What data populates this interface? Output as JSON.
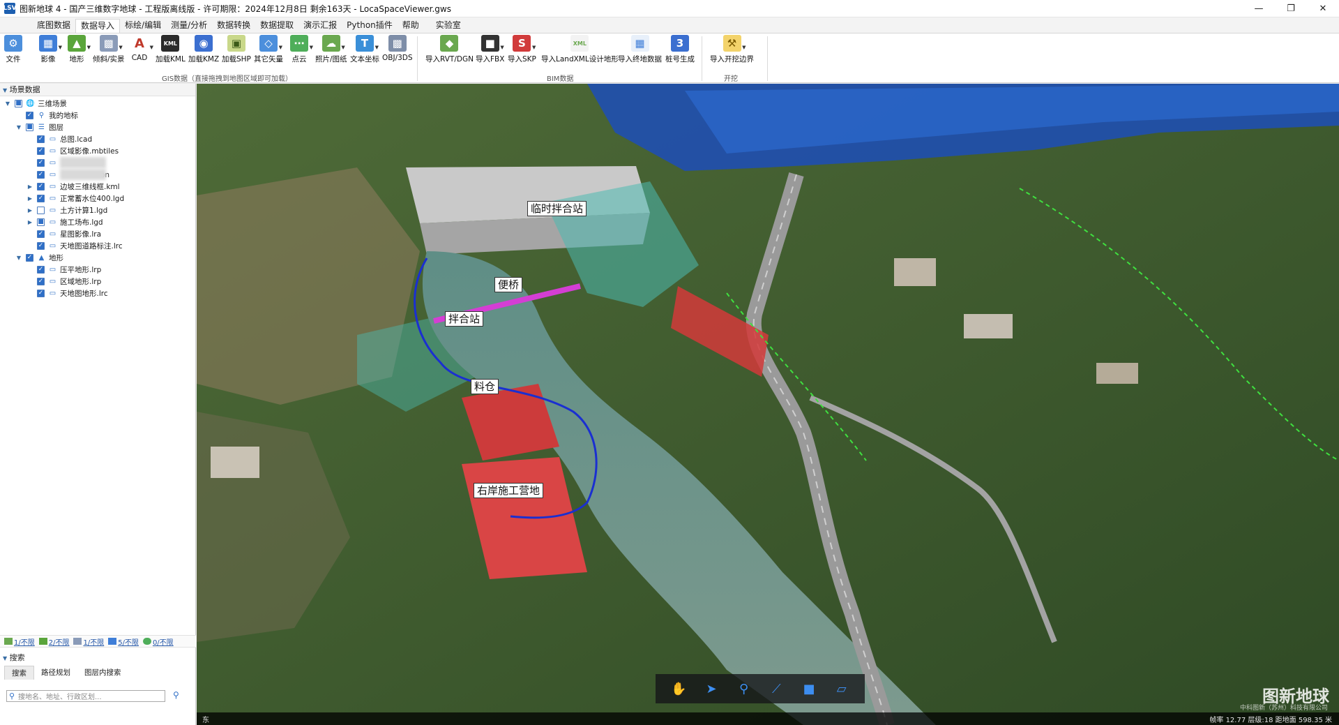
{
  "window": {
    "title": "图新地球 4 - 国产三维数字地球 - 工程版离线版 - 许可期限：2024年12月8日 剩余163天 - LocaSpaceViewer.gws",
    "app_icon": "LSV"
  },
  "menu": {
    "tabs": [
      "底图数据",
      "数据导入",
      "标绘/编辑",
      "测量/分析",
      "数据转换",
      "数据提取",
      "演示汇报",
      "Python插件",
      "帮助",
      "实验室"
    ],
    "active": "数据导入"
  },
  "ribbon": {
    "file": "文件",
    "gis_items": [
      "影像",
      "地形",
      "倾斜/实景",
      "CAD",
      "加载KML",
      "加载KMZ",
      "加载SHP",
      "其它矢量",
      "点云",
      "照片/图纸",
      "文本坐标",
      "OBJ/3DS"
    ],
    "gis_group": "GIS数据（直接拖拽到地图区域即可加载）",
    "bim_items": [
      "导入RVT/DGN",
      "导入FBX",
      "导入SKP",
      "导入LandXML设计地形",
      "导入终地数据",
      "桩号生成"
    ],
    "bim_group": "BIM数据",
    "dig_items": [
      "导入开挖边界"
    ],
    "dig_group": "开挖",
    "icon_colors": [
      "#3f7ed8",
      "#5aa53b",
      "#c0392b",
      "#2b2b2b",
      "#3b6fd0",
      "#6aa84f"
    ]
  },
  "leftpanel": {
    "header": "场景数据",
    "tree": [
      {
        "label": "三维场景",
        "level": 0,
        "expand": "▼",
        "check": "part",
        "icon": "globe-icon"
      },
      {
        "label": "我的地标",
        "level": 1,
        "expand": "",
        "check": "on",
        "icon": "pin-icon"
      },
      {
        "label": "图层",
        "level": 1,
        "expand": "▼",
        "check": "part",
        "icon": "layers-icon"
      },
      {
        "label": "总图.lcad",
        "level": 2,
        "expand": "",
        "check": "on",
        "icon": "layer-icon"
      },
      {
        "label": "区域影像.mbtiles",
        "level": 2,
        "expand": "",
        "check": "on",
        "icon": "layer-icon"
      },
      {
        "label": "",
        "level": 2,
        "expand": "",
        "check": "on",
        "icon": "layer-icon",
        "blurred": true
      },
      {
        "label": "on",
        "level": 2,
        "expand": "",
        "check": "on",
        "icon": "layer-icon",
        "blurred": true
      },
      {
        "label": "边坡三维线框.kml",
        "level": 2,
        "expand": "▶",
        "check": "on",
        "icon": "layer-icon"
      },
      {
        "label": "正常蓄水位400.lgd",
        "level": 2,
        "expand": "▶",
        "check": "on",
        "icon": "layer-icon"
      },
      {
        "label": "土方计算1.lgd",
        "level": 2,
        "expand": "▶",
        "check": "off",
        "icon": "layer-icon"
      },
      {
        "label": "施工场布.lgd",
        "level": 2,
        "expand": "▶",
        "check": "part",
        "icon": "layer-icon"
      },
      {
        "label": "星图影像.lra",
        "level": 2,
        "expand": "",
        "check": "on",
        "icon": "layer-icon"
      },
      {
        "label": "天地图道路标注.lrc",
        "level": 2,
        "expand": "",
        "check": "on",
        "icon": "layer-icon"
      },
      {
        "label": "地形",
        "level": 1,
        "expand": "▼",
        "check": "on",
        "icon": "terrain-icon"
      },
      {
        "label": "压平地形.lrp",
        "level": 2,
        "expand": "",
        "check": "on",
        "icon": "layer-icon"
      },
      {
        "label": "区域地形.lrp",
        "level": 2,
        "expand": "",
        "check": "on",
        "icon": "layer-icon"
      },
      {
        "label": "天地图地形.lrc",
        "level": 2,
        "expand": "",
        "check": "on",
        "icon": "layer-icon"
      }
    ],
    "stats": [
      "1/不限",
      "2/不限",
      "1/不限",
      "5/不限",
      "0/不限"
    ],
    "search": {
      "header": "搜索",
      "tabs": [
        "搜索",
        "路径规划",
        "图层内搜索"
      ],
      "placeholder": "搜地名、地址、行政区划..."
    }
  },
  "map": {
    "labels": [
      "临时拌合站",
      "便桥",
      "拌合站",
      "料仓",
      "右岸施工营地"
    ],
    "watermark": "图新地球",
    "watermark_sub": "中科图新（苏州）科技有限公司",
    "status_compass": "东",
    "status_readout": "帧率 12.77  层级:18  距地面 598.35 米"
  }
}
